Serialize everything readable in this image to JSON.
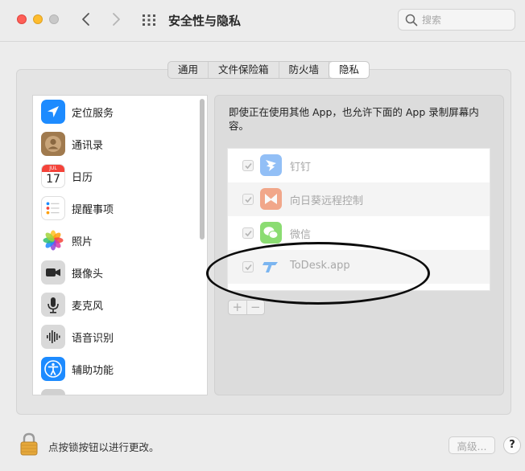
{
  "window": {
    "title": "安全性与隐私"
  },
  "search": {
    "placeholder": "搜索"
  },
  "tabs": [
    {
      "label": "通用",
      "active": false
    },
    {
      "label": "文件保险箱",
      "active": false
    },
    {
      "label": "防火墙",
      "active": false
    },
    {
      "label": "隐私",
      "active": true
    }
  ],
  "sidebar": {
    "items": [
      {
        "label": "定位服务",
        "icon": "location-arrow-icon"
      },
      {
        "label": "通讯录",
        "icon": "contacts-icon"
      },
      {
        "label": "日历",
        "icon": "calendar-icon",
        "icon_month": "JUL",
        "icon_day": "17"
      },
      {
        "label": "提醒事项",
        "icon": "reminders-icon"
      },
      {
        "label": "照片",
        "icon": "photos-icon"
      },
      {
        "label": "摄像头",
        "icon": "camera-icon"
      },
      {
        "label": "麦克风",
        "icon": "microphone-icon"
      },
      {
        "label": "语音识别",
        "icon": "speech-recognition-icon"
      },
      {
        "label": "辅助功能",
        "icon": "accessibility-icon"
      }
    ]
  },
  "main": {
    "description": "即使正在使用其他 App，也允许下面的 App 录制屏幕内容。",
    "apps": [
      {
        "name": "钉钉",
        "checked": true,
        "icon": "dingtalk-icon"
      },
      {
        "name": "向日葵远程控制",
        "checked": true,
        "icon": "sunlogin-icon"
      },
      {
        "name": "微信",
        "checked": true,
        "icon": "wechat-icon"
      },
      {
        "name": "ToDesk.app",
        "checked": true,
        "icon": "todesk-icon"
      }
    ],
    "add_label": "+",
    "remove_label": "−"
  },
  "footer": {
    "lock_text": "点按锁按钮以进行更改。",
    "advanced_label": "高级...",
    "help_label": "?"
  },
  "colors": {
    "accent": "#1d8bff",
    "close": "#fe5f57",
    "minimize": "#febc2e"
  }
}
